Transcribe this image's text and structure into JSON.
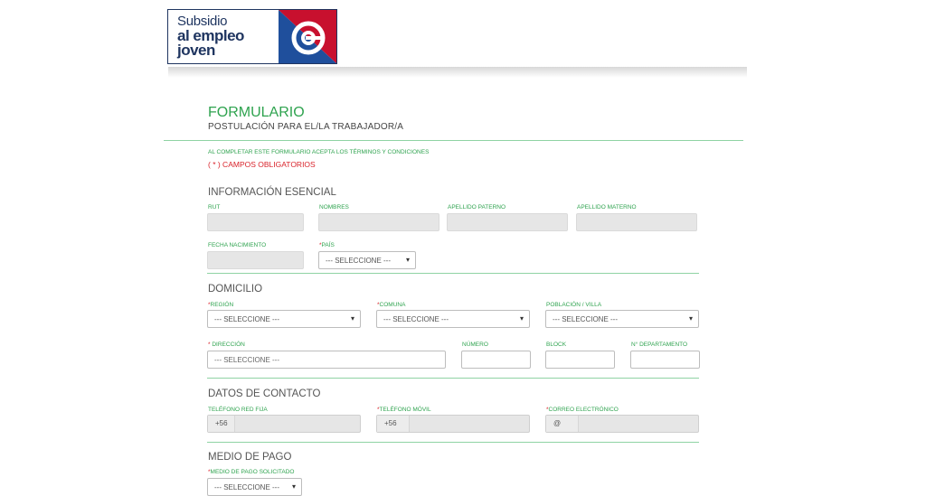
{
  "logo": {
    "line1": "Subsidio",
    "line2": "al empleo",
    "line3": "joven"
  },
  "header": {
    "title": "FORMULARIO",
    "subtitle": "POSTULACIÓN PARA EL/LA TRABAJADOR/A",
    "terms": "AL COMPLETAR ESTE FORMULARIO ACEPTA LOS TÉRMINOS Y CONDICIONES",
    "required_note": "( * ) CAMPOS OBLIGATORIOS"
  },
  "sections": {
    "esencial": {
      "title": "INFORMACIÓN ESENCIAL",
      "rut_label": "RUT",
      "nombres_label": "NOMBRES",
      "apellido_paterno_label": "APELLIDO PATERNO",
      "apellido_materno_label": "APELLIDO MATERNO",
      "fecha_label": "FECHA NACIMIENTO",
      "pais_label": "PAÍS",
      "pais_value": "--- SELECCIONE ---"
    },
    "domicilio": {
      "title": "DOMICILIO",
      "region_label": "REGIÓN",
      "region_value": "--- SELECCIONE ---",
      "comuna_label": "COMUNA",
      "comuna_value": "--- SELECCIONE ---",
      "poblacion_label": "POBLACIÓN / VILLA",
      "poblacion_value": "--- SELECCIONE ---",
      "direccion_label": "DIRECCIÓN",
      "direccion_value": "--- SELECCIONE ---",
      "numero_label": "NÚMERO",
      "block_label": "BLOCK",
      "departamento_label": "N° DEPARTAMENTO"
    },
    "contacto": {
      "title": "DATOS DE CONTACTO",
      "telefono_fijo_label": "TELÉFONO RED FIJA",
      "telefono_fijo_prefix": "+56",
      "telefono_movil_label": "TELÉFONO MÓVIL",
      "telefono_movil_prefix": "+56",
      "correo_label": "CORREO ELECTRÓNICO",
      "correo_prefix": "@"
    },
    "pago": {
      "title": "MEDIO DE PAGO",
      "medio_label": "MEDIO DE PAGO SOLICITADO",
      "medio_value": "--- SELECCIONE ---"
    }
  },
  "required_mark": "*",
  "caret": "▾",
  "colors": {
    "green": "#2fa34f",
    "red": "#d9232b",
    "navy": "#1f3560"
  }
}
